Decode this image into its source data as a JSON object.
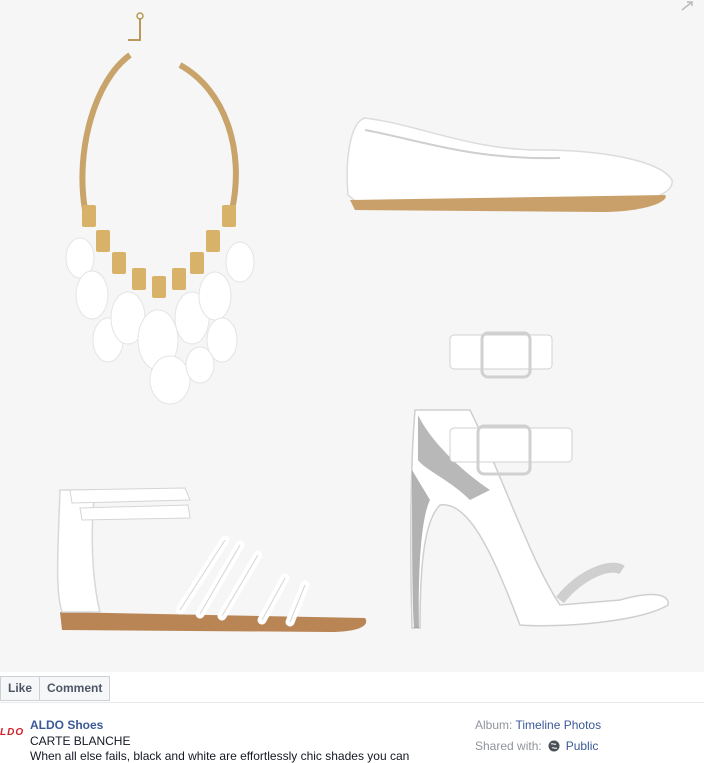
{
  "post": {
    "page_name": "ALDO Shoes",
    "logo_text": "LDO",
    "title": "CARTE BLANCHE",
    "caption": "When all else fails, black and white are effortlessly chic shades you can"
  },
  "actions": {
    "like": "Like",
    "comment": "Comment"
  },
  "album": {
    "label": "Album:",
    "value": "Timeline Photos"
  },
  "sharing": {
    "label": "Shared with:",
    "value": "Public"
  },
  "photo": {
    "items": [
      "necklace-icon",
      "loafer-icon",
      "gladiator-sandal-icon",
      "high-heel-sandal-icon"
    ]
  },
  "colors": {
    "link": "#3b5998",
    "muted": "#90949c",
    "brand_red": "#d21f2a"
  }
}
